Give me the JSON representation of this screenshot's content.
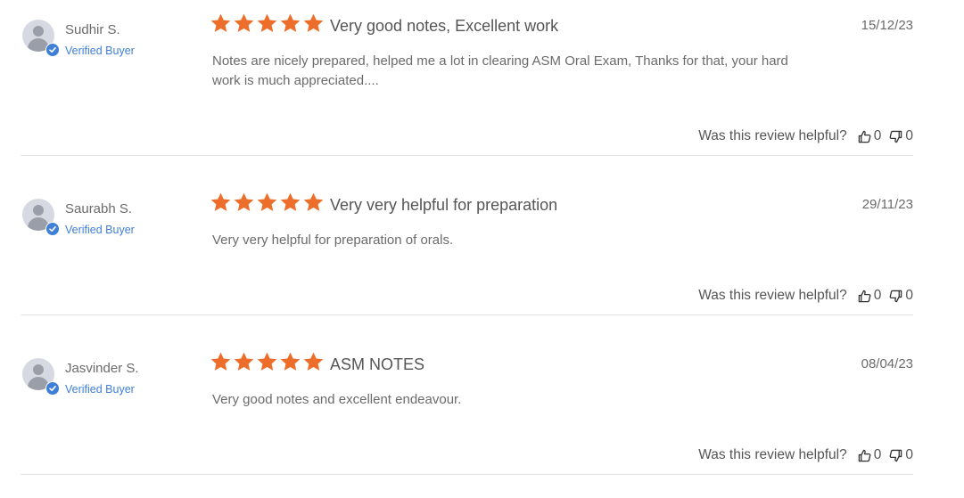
{
  "colors": {
    "star": "#ec6e2a",
    "verified": "#3f7fd6",
    "divider": "#e3e3e3"
  },
  "helpful_prompt": "Was this review helpful?",
  "reviews": [
    {
      "name": "Sudhir S.",
      "badge": "Verified Buyer",
      "rating": 5,
      "title": "Very good notes, Excellent work",
      "date": "15/12/23",
      "body": "Notes are nicely prepared, helped me a lot in clearing ASM Oral Exam, Thanks for that, your hard work is much appreciated....",
      "helpful_yes": "0",
      "helpful_no": "0"
    },
    {
      "name": "Saurabh S.",
      "badge": "Verified Buyer",
      "rating": 5,
      "title": "Very very helpful for preparation",
      "date": "29/11/23",
      "body": "Very very helpful for preparation of orals.",
      "helpful_yes": "0",
      "helpful_no": "0"
    },
    {
      "name": "Jasvinder S.",
      "badge": "Verified Buyer",
      "rating": 5,
      "title": "ASM NOTES",
      "date": "08/04/23",
      "body": "Very good notes and excellent endeavour.",
      "helpful_yes": "0",
      "helpful_no": "0"
    }
  ]
}
